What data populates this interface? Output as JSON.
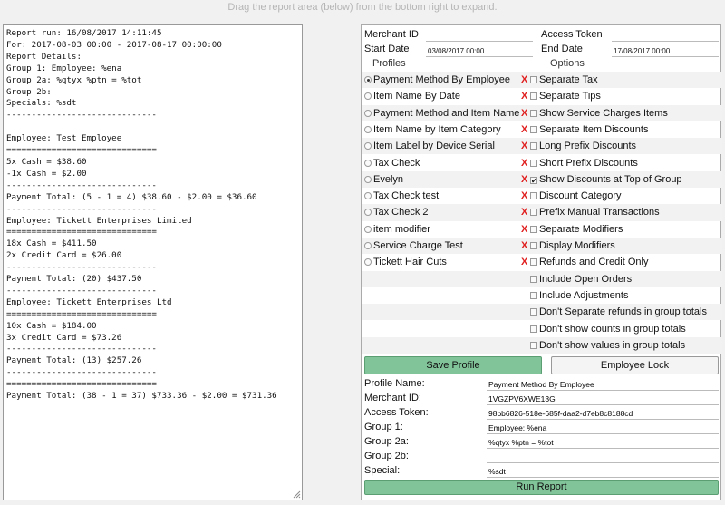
{
  "hint": "Drag the report area (below) from the bottom right to expand.",
  "report_text": "Report run: 16/08/2017 14:11:45\nFor: 2017-08-03 00:00 - 2017-08-17 00:00:00\nReport Details:\nGroup 1: Employee: %ena\nGroup 2a: %qtyx %ptn = %tot\nGroup 2b:\nSpecials: %sdt\n------------------------------\n\nEmployee: Test Employee\n==============================\n5x Cash = $38.60\n-1x Cash = $2.00\n------------------------------\nPayment Total: (5 - 1 = 4) $38.60 - $2.00 = $36.60\n------------------------------\nEmployee: Tickett Enterprises Limited\n==============================\n18x Cash = $411.50\n2x Credit Card = $26.00\n------------------------------\nPayment Total: (20) $437.50\n------------------------------\nEmployee: Tickett Enterprises Ltd\n==============================\n10x Cash = $184.00\n3x Credit Card = $73.26\n------------------------------\nPayment Total: (13) $257.26\n------------------------------\n==============================\nPayment Total: (38 - 1 = 37) $733.36 - $2.00 = $731.36",
  "top": {
    "merchant_id_label": "Merchant ID",
    "merchant_id_value": "",
    "access_token_label": "Access Token",
    "access_token_value": "",
    "start_date_label": "Start Date",
    "start_date_value": "03/08/2017 00:00",
    "end_date_label": "End Date",
    "end_date_value": "17/08/2017 00:00",
    "profiles_header": "Profiles",
    "options_header": "Options"
  },
  "profiles": [
    {
      "label": "Payment Method By Employee",
      "selected": true
    },
    {
      "label": "Item Name By Date",
      "selected": false
    },
    {
      "label": "Payment Method and Item Name",
      "selected": false
    },
    {
      "label": "Item Name by Item Category",
      "selected": false
    },
    {
      "label": "Item Label by Device Serial",
      "selected": false
    },
    {
      "label": "Tax Check",
      "selected": false
    },
    {
      "label": "Evelyn",
      "selected": false
    },
    {
      "label": "Tax Check test",
      "selected": false
    },
    {
      "label": "Tax Check 2",
      "selected": false
    },
    {
      "label": "item modifier",
      "selected": false
    },
    {
      "label": "Service Charge Test",
      "selected": false
    },
    {
      "label": "Tickett Hair Cuts",
      "selected": false
    }
  ],
  "delete_symbol": "X",
  "options": [
    {
      "label": "Separate Tax",
      "checked": false
    },
    {
      "label": "Separate Tips",
      "checked": false
    },
    {
      "label": "Show Service Charges Items",
      "checked": false
    },
    {
      "label": "Separate Item Discounts",
      "checked": false
    },
    {
      "label": "Long Prefix Discounts",
      "checked": false
    },
    {
      "label": "Short Prefix Discounts",
      "checked": false
    },
    {
      "label": "Show Discounts at Top of Group",
      "checked": true
    },
    {
      "label": "Discount Category",
      "checked": false
    },
    {
      "label": "Prefix Manual Transactions",
      "checked": false
    },
    {
      "label": "Separate Modifiers",
      "checked": false
    },
    {
      "label": "Display Modifiers",
      "checked": false
    },
    {
      "label": "Refunds and Credit Only",
      "checked": false
    },
    {
      "label": "Include Open Orders",
      "checked": false
    },
    {
      "label": "Include Adjustments",
      "checked": false
    },
    {
      "label": "Don't Separate refunds in group totals",
      "checked": false
    },
    {
      "label": "Don't show counts in group totals",
      "checked": false
    },
    {
      "label": "Don't show values in group totals",
      "checked": false
    }
  ],
  "buttons": {
    "save_profile": "Save Profile",
    "employee_lock": "Employee Lock",
    "run_report": "Run Report"
  },
  "form": {
    "profile_name_label": "Profile Name:",
    "profile_name_value": "Payment Method By Employee",
    "merchant_id_label": "Merchant ID:",
    "merchant_id_value": "1VGZPV6XWE13G",
    "access_token_label": "Access Token:",
    "access_token_value": "98bb6826-518e-685f-daa2-d7eb8c8188cd",
    "group1_label": "Group 1:",
    "group1_value": "Employee: %ena",
    "group2a_label": "Group 2a:",
    "group2a_value": "%qtyx %ptn = %tot",
    "group2b_label": "Group 2b:",
    "group2b_value": "",
    "special_label": "Special:",
    "special_value": "%sdt"
  },
  "colors": {
    "button_green": "#82c49a",
    "delete_red": "#e02020"
  }
}
